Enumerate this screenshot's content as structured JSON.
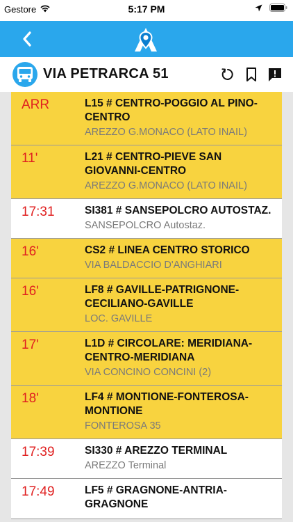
{
  "status": {
    "carrier": "Gestore",
    "time": "5:17 PM"
  },
  "stop": {
    "name": "VIA PETRARCA 51"
  },
  "departures": [
    {
      "time": "ARR",
      "line": "L15 # CENTRO-POGGIO AL PINO-CENTRO",
      "dest": "AREZZO G.MONACO (LATO INAIL)",
      "style": "yellow"
    },
    {
      "time": "11'",
      "line": "L21 # CENTRO-PIEVE SAN GIOVANNI-CENTRO",
      "dest": "AREZZO G.MONACO (LATO INAIL)",
      "style": "yellow"
    },
    {
      "time": "17:31",
      "line": "SI381 # SANSEPOLCRO AUTOSTAZ.",
      "dest": "SANSEPOLCRO Autostaz.",
      "style": "white"
    },
    {
      "time": "16'",
      "line": "CS2 # LINEA CENTRO STORICO",
      "dest": "VIA BALDACCIO D'ANGHIARI",
      "style": "yellow"
    },
    {
      "time": "16'",
      "line": "LF8 # GAVILLE-PATRIGNONE-CECILIANO-GAVILLE",
      "dest": "LOC. GAVILLE",
      "style": "yellow"
    },
    {
      "time": "17'",
      "line": "L1D # CIRCOLARE: MERIDIANA-CENTRO-MERIDIANA",
      "dest": "VIA CONCINO CONCINI (2)",
      "style": "yellow"
    },
    {
      "time": "18'",
      "line": "LF4 # MONTIONE-FONTEROSA-MONTIONE",
      "dest": "FONTEROSA 35",
      "style": "yellow"
    },
    {
      "time": "17:39",
      "line": "SI330 # AREZZO TERMINAL",
      "dest": "AREZZO Terminal",
      "style": "white"
    },
    {
      "time": "17:49",
      "line": "LF5 # GRAGNONE-ANTRIA-GRAGNONE",
      "dest": "",
      "style": "white"
    }
  ]
}
